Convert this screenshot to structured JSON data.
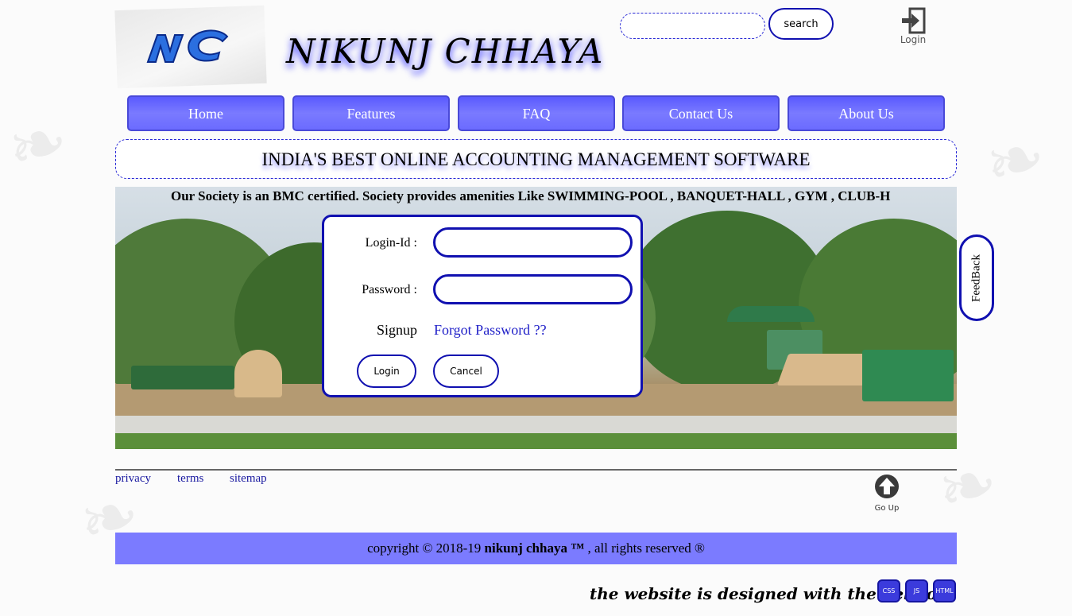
{
  "header": {
    "title": "NIKUNJ CHHAYA",
    "search": {
      "placeholder": "",
      "value": "",
      "button_label": "search"
    },
    "login_label": "Login"
  },
  "nav": {
    "items": [
      {
        "label": "Home"
      },
      {
        "label": "Features"
      },
      {
        "label": "FAQ"
      },
      {
        "label": "Contact Us"
      },
      {
        "label": "About Us"
      }
    ]
  },
  "tagline": "INDIA'S BEST ONLINE ACCOUNTING MANAGEMENT SOFTWARE",
  "marquee": "Our Society is an BMC certified. Society provides amenities Like SWIMMING-POOL , BANQUET-HALL , GYM , CLUB-H",
  "login_form": {
    "login_id_label": "Login-Id :",
    "password_label": "Password :",
    "signup_label": "Signup",
    "forgot_label": "Forgot Password ??",
    "login_button": "Login",
    "cancel_button": "Cancel"
  },
  "feedback_label": "FeedBack",
  "footer": {
    "links": [
      {
        "label": "privacy"
      },
      {
        "label": "terms"
      },
      {
        "label": "sitemap"
      }
    ],
    "go_up_label": "Go Up",
    "copyright_prefix": "copyright © 2018-19 ",
    "copyright_brand": "nikunj chhaya ™",
    "copyright_suffix": " , all rights reserved ®",
    "credits": "the website is designed with the help of",
    "badges": [
      "CSS",
      "JS",
      "HTML"
    ]
  },
  "colors": {
    "accent": "#1010b0",
    "nav_bg": "#6b6bff",
    "footer_bg": "#7b7bff"
  }
}
